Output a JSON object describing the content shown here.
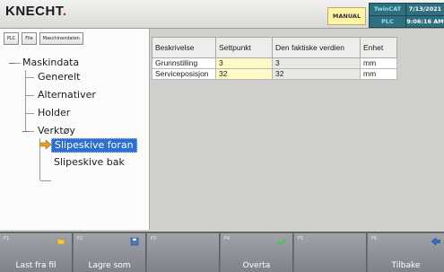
{
  "header": {
    "logo_text": "KNECHT",
    "mode": "MANUAL",
    "system": "TwinCAT",
    "controller": "PLC",
    "date": "7/13/2021",
    "time": "9:06:16 AM"
  },
  "toolbar": {
    "plc": "PLC",
    "file": "File",
    "machine_data": "Maschinendaten"
  },
  "tree": {
    "root": "Maskindata",
    "items": [
      "Generelt",
      "Alternativer",
      "Holder",
      "Verktøy"
    ],
    "tool_children": [
      "Slipeskive foran",
      "Slipeskive bak"
    ],
    "selected": "Slipeskive foran"
  },
  "table": {
    "headers": [
      "Beskrivelse",
      "Settpunkt",
      "Den faktiske verdien",
      "Enhet"
    ],
    "rows": [
      {
        "description": "Grunnstilling",
        "setpoint": "3",
        "actual": "3",
        "unit": "mm"
      },
      {
        "description": "Serviceposisjon",
        "setpoint": "32",
        "actual": "32",
        "unit": "mm"
      }
    ]
  },
  "function_keys": [
    {
      "key": "F1",
      "label": "Last fra fil",
      "icon": "folder-icon"
    },
    {
      "key": "F2",
      "label": "Lagre som",
      "icon": "save-icon"
    },
    {
      "key": "F3",
      "label": "",
      "icon": ""
    },
    {
      "key": "F4",
      "label": "Overta",
      "icon": "checkmark-icon"
    },
    {
      "key": "F5",
      "label": "",
      "icon": ""
    },
    {
      "key": "F6",
      "label": "Tilbake",
      "icon": "back-arrow-icon"
    }
  ],
  "colors": {
    "selection": "#2d6ed1",
    "editable_cell": "#fff9c8",
    "status_box": "#2f6f7f",
    "logo_accent": "#d21414"
  }
}
